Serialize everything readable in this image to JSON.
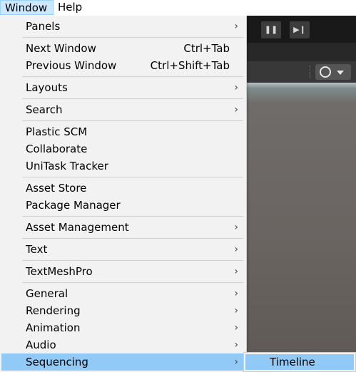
{
  "menubar": {
    "window_label": "Window",
    "help_label": "Help"
  },
  "window_menu": {
    "panels": "Panels",
    "next_window": "Next Window",
    "next_window_shortcut": "Ctrl+Tab",
    "previous_window": "Previous Window",
    "previous_window_shortcut": "Ctrl+Shift+Tab",
    "layouts": "Layouts",
    "search": "Search",
    "plastic_scm": "Plastic SCM",
    "collaborate": "Collaborate",
    "unitask_tracker": "UniTask Tracker",
    "asset_store": "Asset Store",
    "package_manager": "Package Manager",
    "asset_management": "Asset Management",
    "text": "Text",
    "textmeshpro": "TextMeshPro",
    "general": "General",
    "rendering": "Rendering",
    "animation": "Animation",
    "audio": "Audio",
    "sequencing": "Sequencing",
    "submenu_arrow": "›"
  },
  "sequencing_submenu": {
    "timeline": "Timeline"
  },
  "editor_toolbar": {
    "pause_symbol": "❚❚",
    "step_symbol": "▶❙"
  },
  "colors": {
    "highlight": "#91c9f7",
    "menu_background": "#f2f2f2",
    "editor_dark": "#282828"
  },
  "icons": [
    "submenu-arrow-icon",
    "pause-icon",
    "step-icon",
    "scene-gizmo-icon",
    "chevron-down-icon"
  ]
}
